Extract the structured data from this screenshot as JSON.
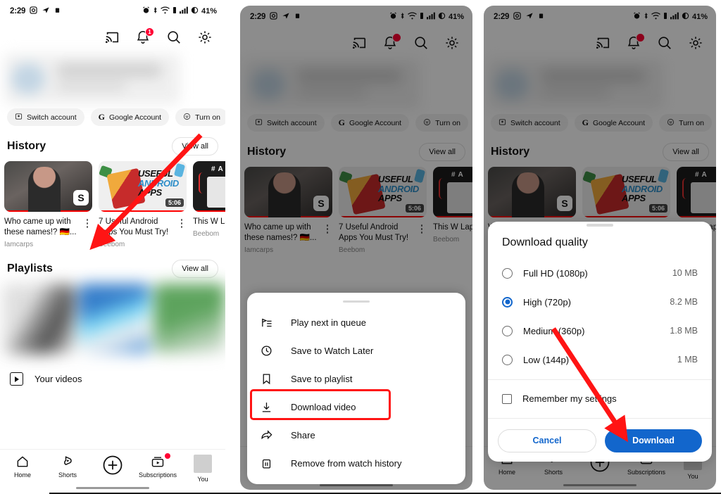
{
  "status_bar": {
    "time": "2:29",
    "left_icons": [
      "instagram-icon",
      "telegram-icon",
      "app-icon"
    ],
    "right_icons": [
      "alarm-icon",
      "bluetooth-icon",
      "wifi-icon",
      "vibrate-icon",
      "signal-icon"
    ],
    "battery_percent": "41%"
  },
  "header": {
    "icons": [
      "cast-icon",
      "notifications-icon",
      "search-icon",
      "settings-icon"
    ],
    "notification_count": "1"
  },
  "chips": [
    {
      "label": "Switch account",
      "icon": "switch-account-icon"
    },
    {
      "label": "Google Account",
      "icon": "google-g-icon"
    },
    {
      "label": "Turn on",
      "icon": "incognito-icon"
    }
  ],
  "sections": {
    "history": {
      "title": "History",
      "view_all": "View all"
    },
    "playlists": {
      "title": "Playlists",
      "view_all": "View all"
    }
  },
  "history_videos": [
    {
      "title": "Who came up with these names!? 🇩🇪...",
      "channel": "Iamcarps",
      "duration": ""
    },
    {
      "title": "7 Useful Android Apps You Must Try!",
      "channel": "Beebom",
      "duration": "5:06",
      "thumb_text": {
        "line1": "USEFUL",
        "line2": "ANDROID",
        "line3": "APPS"
      }
    },
    {
      "title": "This W Laptop",
      "channel": "Beebom",
      "duration": ""
    }
  ],
  "your_videos": {
    "label": "Your videos",
    "icon": "video-library-icon"
  },
  "bottom_nav": [
    {
      "label": "Home",
      "icon": "home-icon"
    },
    {
      "label": "Shorts",
      "icon": "shorts-icon"
    },
    {
      "label": "",
      "icon": "create-plus-icon"
    },
    {
      "label": "Subscriptions",
      "icon": "subscriptions-icon"
    },
    {
      "label": "You",
      "icon": "avatar-icon"
    }
  ],
  "context_menu": {
    "items": [
      {
        "label": "Play next in queue",
        "icon": "play-next-icon"
      },
      {
        "label": "Save to Watch Later",
        "icon": "clock-icon"
      },
      {
        "label": "Save to playlist",
        "icon": "bookmark-icon"
      },
      {
        "label": "Download video",
        "icon": "download-icon",
        "highlighted": true
      },
      {
        "label": "Share",
        "icon": "share-icon"
      },
      {
        "label": "Remove from watch history",
        "icon": "trash-icon"
      }
    ]
  },
  "download_dialog": {
    "title": "Download quality",
    "options": [
      {
        "label": "Full HD (1080p)",
        "size": "10 MB",
        "selected": false
      },
      {
        "label": "High (720p)",
        "size": "8.2 MB",
        "selected": true
      },
      {
        "label": "Medium (360p)",
        "size": "1.8 MB",
        "selected": false
      },
      {
        "label": "Low (144p)",
        "size": "1 MB",
        "selected": false
      }
    ],
    "remember_label": "Remember my settings",
    "remember_checked": false,
    "cancel_label": "Cancel",
    "download_label": "Download"
  },
  "annotations": {
    "arrow_color": "#ff1414",
    "highlight_box_color": "#ff1414"
  }
}
